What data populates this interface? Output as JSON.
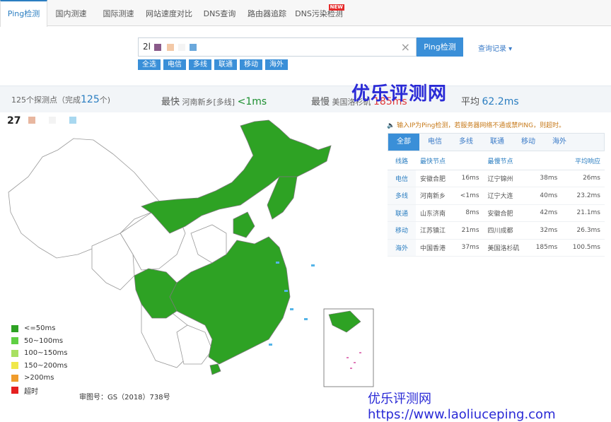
{
  "tabs": [
    {
      "label": "Ping检测",
      "active": true
    },
    {
      "label": "国内测速"
    },
    {
      "label": "国际测速"
    },
    {
      "label": "网站速度对比"
    },
    {
      "label": "DNS查询"
    },
    {
      "label": "路由器追踪"
    },
    {
      "label": "DNS污染检测",
      "badge": "NEW"
    }
  ],
  "search": {
    "value": "2l",
    "ping_label": "Ping检测",
    "history_label": "查询记录 ▾"
  },
  "filters": [
    "全选",
    "电信",
    "多线",
    "联通",
    "移动",
    "海外"
  ],
  "stats": {
    "probe_prefix": "125个探测点（完成",
    "probe_count": "125",
    "probe_suffix": "个)",
    "fastest_label": "最快",
    "fastest_node": "河南新乡[多线]",
    "fastest_value": "<1ms",
    "slowest_label": "最慢",
    "slowest_node": "美国洛杉矶",
    "slowest_value": "185ms",
    "avg_label": "平均",
    "avg_value": "62.2ms"
  },
  "watermark_top": "优乐评测网",
  "map_header": "27",
  "legend": [
    {
      "label": "<=50ms",
      "color": "#2ea224"
    },
    {
      "label": "50~100ms",
      "color": "#5fd043"
    },
    {
      "label": "100~150ms",
      "color": "#a8e062"
    },
    {
      "label": "150~200ms",
      "color": "#f0e84a"
    },
    {
      "label": ">200ms",
      "color": "#f09c2c"
    },
    {
      "label": "超时",
      "color": "#e52020"
    }
  ],
  "map_note": "审图号：GS（2018）738号",
  "watermark_bottom": "优乐评测网https://www.laoliuceping.com",
  "tip": "输入IP为Ping检测，若服务器网络不通或禁PING，则超时。",
  "result_tabs": [
    {
      "label": "全部",
      "active": true
    },
    {
      "label": "电信"
    },
    {
      "label": "多线"
    },
    {
      "label": "联通"
    },
    {
      "label": "移动"
    },
    {
      "label": "海外"
    }
  ],
  "table": {
    "headers": [
      "线路",
      "最快节点",
      "最慢节点",
      "平均响应"
    ],
    "rows": [
      {
        "line": "电信",
        "fast": "安徽合肥",
        "fast_ms": "16ms",
        "slow": "辽宁锦州",
        "slow_ms": "38ms",
        "avg": "26ms"
      },
      {
        "line": "多线",
        "fast": "河南新乡",
        "fast_ms": "<1ms",
        "slow": "辽宁大连",
        "slow_ms": "40ms",
        "avg": "23.2ms"
      },
      {
        "line": "联通",
        "fast": "山东济南",
        "fast_ms": "8ms",
        "slow": "安徽合肥",
        "slow_ms": "42ms",
        "avg": "21.1ms"
      },
      {
        "line": "移动",
        "fast": "江苏镇江",
        "fast_ms": "21ms",
        "slow": "四川成都",
        "slow_ms": "32ms",
        "avg": "26.3ms"
      },
      {
        "line": "海外",
        "fast": "中国香港",
        "fast_ms": "37ms",
        "slow": "美国洛杉矶",
        "slow_ms": "185ms",
        "avg": "100.5ms"
      }
    ]
  },
  "colors": {
    "accent": "#3a8fd8",
    "map_green": "#2ea224"
  }
}
